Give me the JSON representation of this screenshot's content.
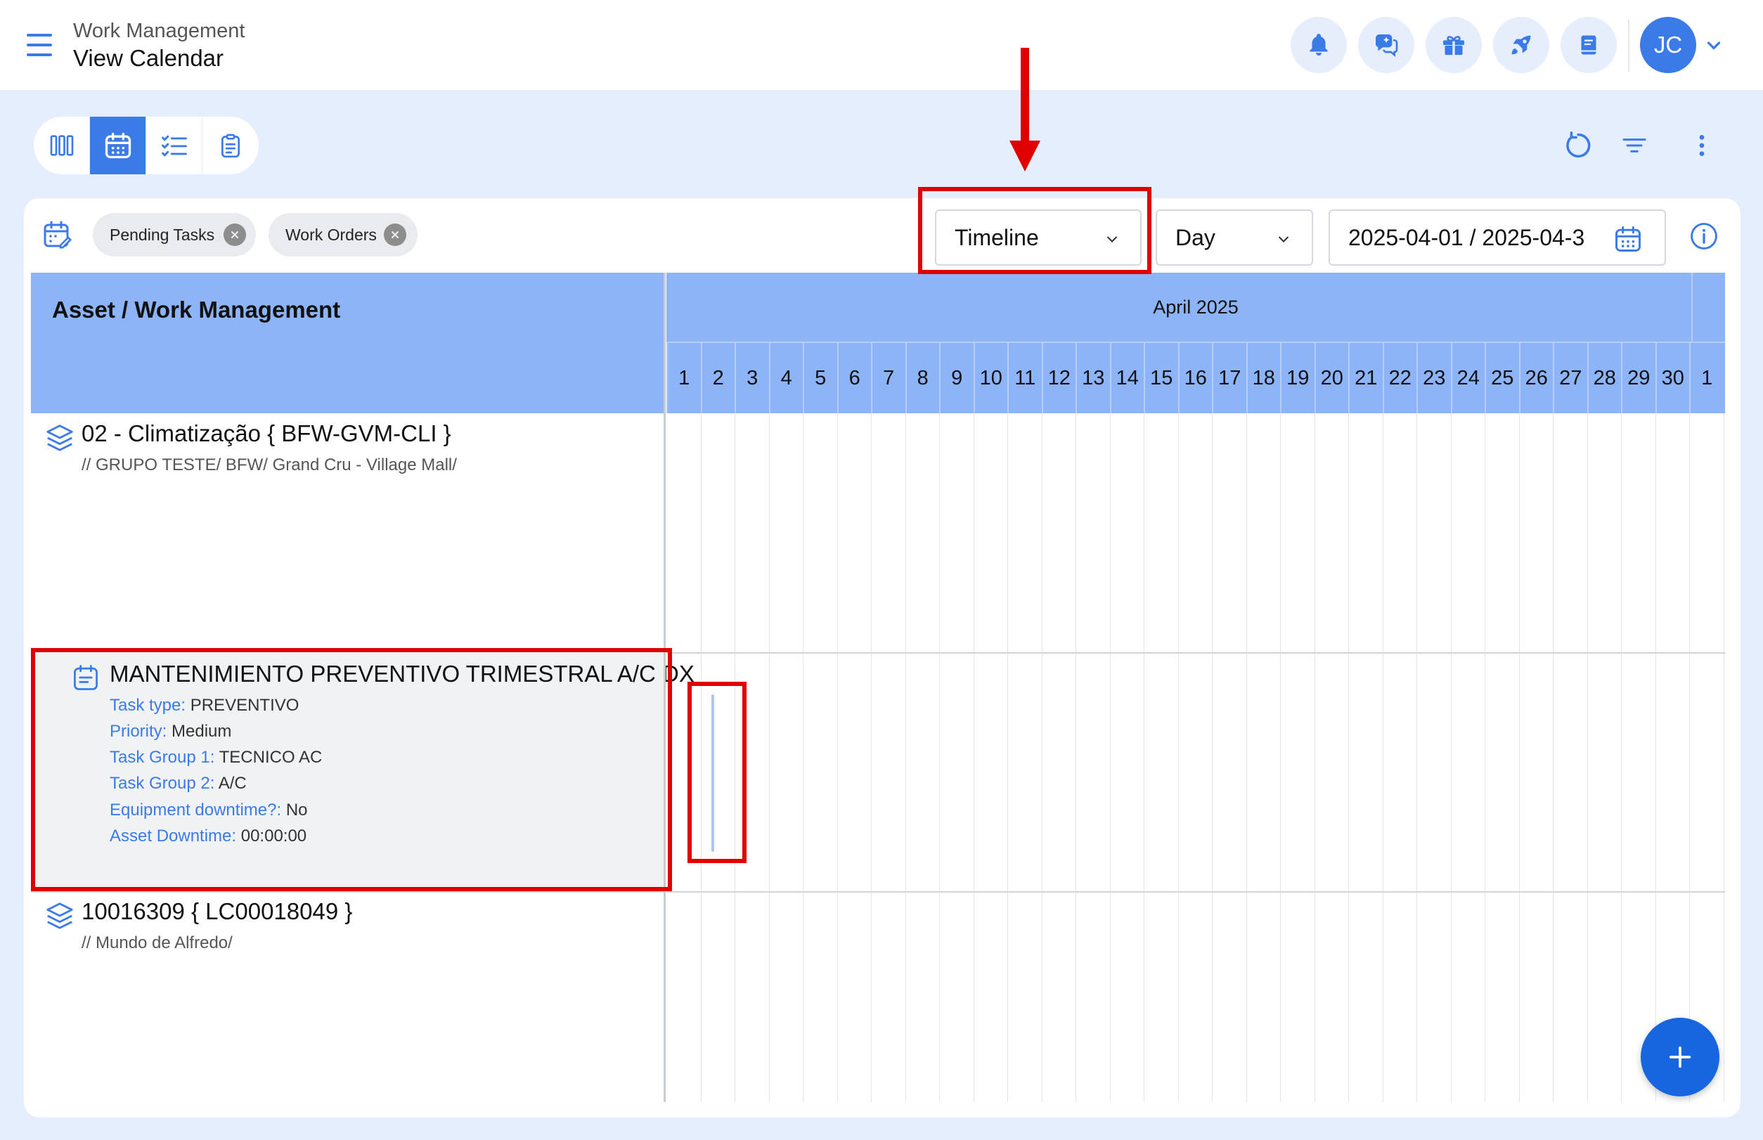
{
  "header": {
    "parent": "Work Management",
    "title": "View Calendar",
    "avatar_initials": "JC",
    "icons": [
      "bell-icon",
      "chat-icon",
      "gift-icon",
      "rocket-icon",
      "book-icon"
    ]
  },
  "toolbar": {
    "views": [
      "board-view",
      "calendar-view",
      "checklist-view",
      "clipboard-view"
    ],
    "active_view": "calendar-view",
    "actions": [
      "refresh-icon",
      "filter-icon",
      "more-vertical-icon"
    ]
  },
  "filters": {
    "chips": [
      "Pending Tasks",
      "Work Orders"
    ],
    "view_mode": "Timeline",
    "scale": "Day",
    "date_range": "2025-04-01 / 2025-04-3"
  },
  "grid": {
    "left_header": "Asset / Work Management",
    "month": "April 2025",
    "days": [
      "1",
      "2",
      "3",
      "4",
      "5",
      "6",
      "7",
      "8",
      "9",
      "10",
      "11",
      "12",
      "13",
      "14",
      "15",
      "16",
      "17",
      "18",
      "19",
      "20",
      "21",
      "22",
      "23",
      "24",
      "25",
      "26",
      "27",
      "28",
      "29",
      "30",
      "1"
    ]
  },
  "rows": {
    "asset1": {
      "title": "02 - Climatização { BFW-GVM-CLI }",
      "path": "// GRUPO TESTE/ BFW/ Grand Cru - Village Mall/"
    },
    "task": {
      "title": "MANTENIMIENTO PREVENTIVO TRIMESTRAL A/C DX",
      "fields": [
        {
          "label": "Task type:",
          "value": "PREVENTIVO"
        },
        {
          "label": "Priority:",
          "value": "Medium"
        },
        {
          "label": "Task Group 1:",
          "value": "TECNICO AC"
        },
        {
          "label": "Task Group 2:",
          "value": "A/C"
        },
        {
          "label": "Equipment downtime?:",
          "value": "No"
        },
        {
          "label": "Asset Downtime:",
          "value": "00:00:00"
        }
      ]
    },
    "asset2": {
      "title": "10016309 { LC00018049 }",
      "path": "// Mundo de Alfredo/"
    }
  },
  "colors": {
    "accent": "#3b7be8",
    "header_blue": "#8cb4f7",
    "highlight": "#e00000",
    "fab": "#1766e0"
  }
}
